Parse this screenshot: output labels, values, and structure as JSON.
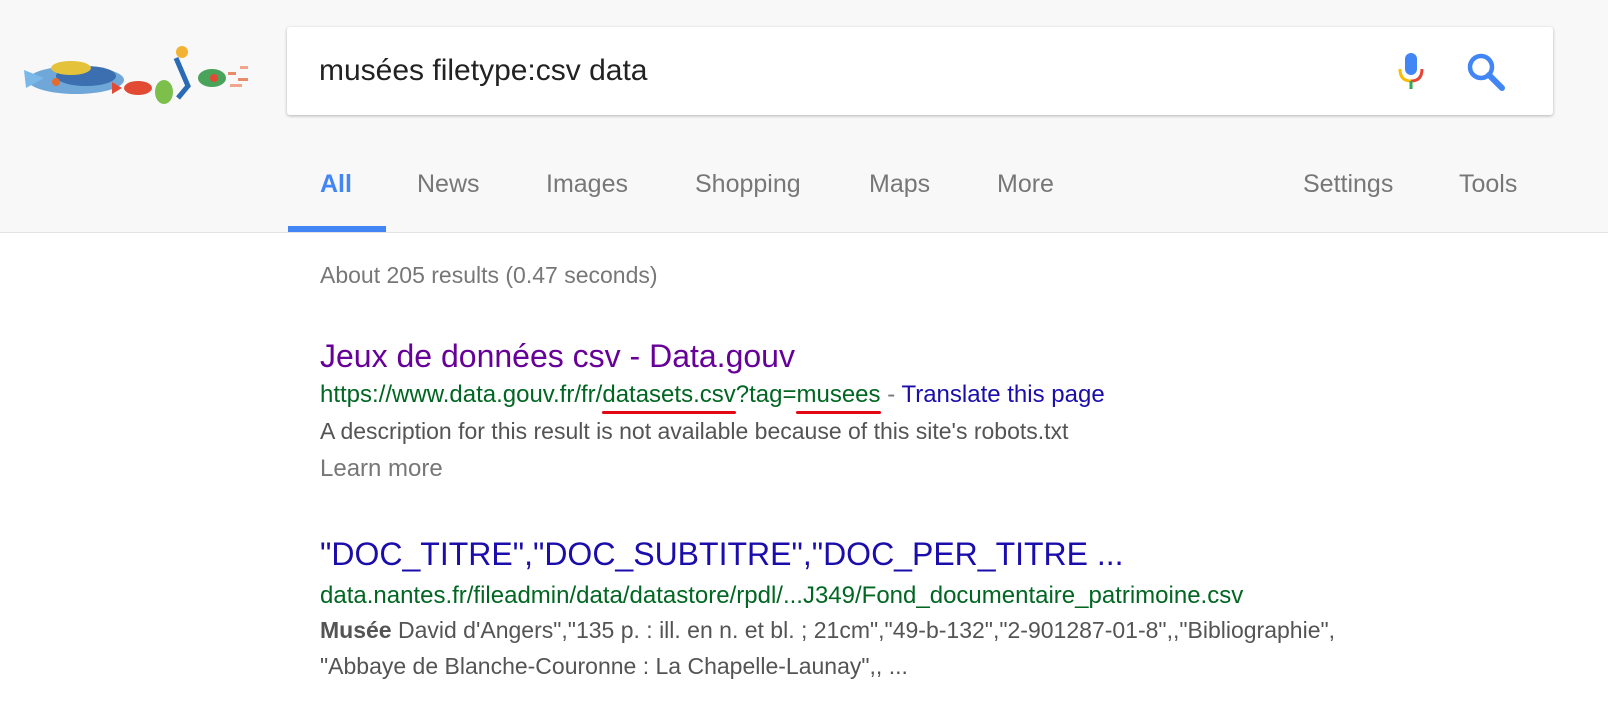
{
  "search": {
    "query": "musées filetype:csv data"
  },
  "tabs": [
    {
      "label": "All"
    },
    {
      "label": "News"
    },
    {
      "label": "Images"
    },
    {
      "label": "Shopping"
    },
    {
      "label": "Maps"
    },
    {
      "label": "More"
    }
  ],
  "settings_label": "Settings",
  "tools_label": "Tools",
  "results_stats": "About 205 results (0.47 seconds)",
  "results": [
    {
      "title": "Jeux de données csv - Data.gouv",
      "url_parts": [
        "https://www.data.gouv.fr/fr/",
        "datasets.csv",
        "?tag=",
        "musees"
      ],
      "separator": " - ",
      "translate_label": "Translate this page",
      "description": "A description for this result is not available because of this site's robots.txt",
      "learn_more": "Learn more"
    },
    {
      "title": "\"DOC_TITRE\",\"DOC_SUBTITRE\",\"DOC_PER_TITRE ...",
      "url": "data.nantes.fr/fileadmin/data/datastore/rpdl/...J349/Fond_documentaire_patrimoine.csv",
      "snippet_bold": "Musée",
      "snippet_line1": " David d'Angers\",\"135 p. : ill. en n. et bl. ; 21cm\",\"49-b-132\",\"2-901287-01-8\",,\"Bibliographie\",",
      "snippet_line2": "\"Abbaye de Blanche-Couronne : La Chapelle-Launay\",, ..."
    }
  ],
  "colors": {
    "accent": "#4285f4",
    "visited_link": "#660099",
    "link": "#1a0dab",
    "url_green": "#006621",
    "annotation_red": "#e30613"
  }
}
